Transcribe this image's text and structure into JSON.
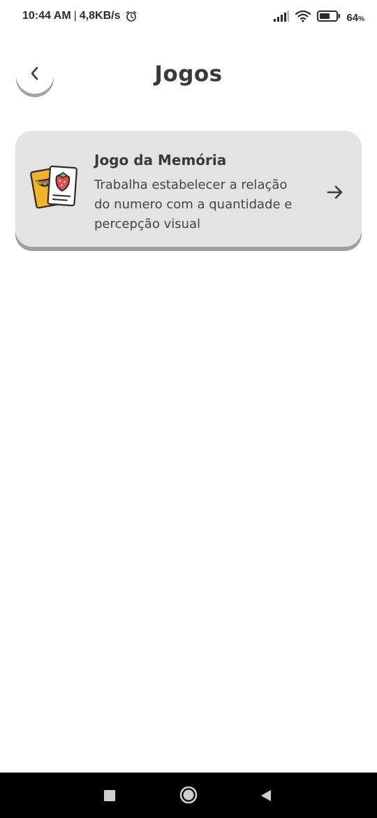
{
  "status_bar": {
    "time": "10:44 AM",
    "separator": "|",
    "network_speed": "4,8KB/s",
    "battery_percent": "64",
    "battery_unit": "%",
    "battery_level": 0.64,
    "icons": [
      "alarm-icon",
      "signal-icon",
      "wifi-icon",
      "battery-icon"
    ]
  },
  "header": {
    "title": "Jogos",
    "back_icon": "chevron-left-icon"
  },
  "games": [
    {
      "title": "Jogo da Memória",
      "description": "Trabalha estabelecer a relação do numero com a quantidade e percepção visual",
      "icon": "memory-cards-icon",
      "action_icon": "arrow-right-icon"
    }
  ],
  "nav_bar": {
    "buttons": [
      "recent-apps-icon",
      "home-icon",
      "back-triangle-icon"
    ]
  },
  "colors": {
    "card_background": "#e3e3e3",
    "card_shadow": "#9e9e9e",
    "text_primary": "#3a3a3a",
    "nav_background": "#000000"
  }
}
